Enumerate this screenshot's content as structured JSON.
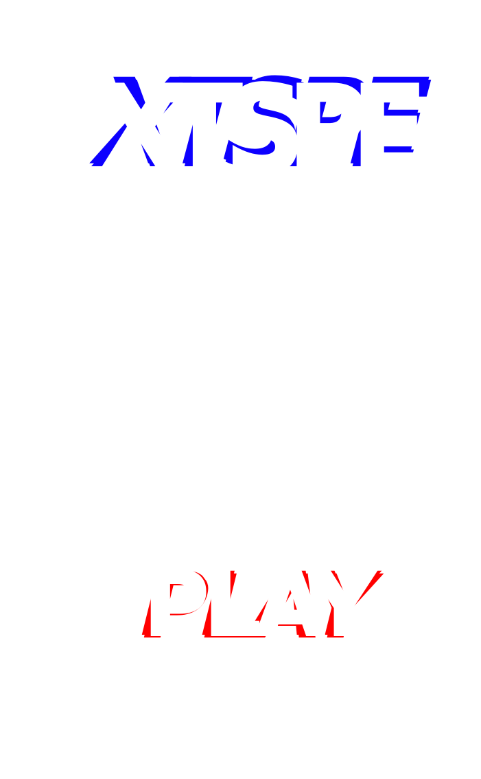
{
  "title": {
    "text": "XTSPE",
    "shadow_color": "#0d00ff",
    "front_color": "#ffffff"
  },
  "play_button": {
    "label": "PLAY",
    "shadow_color": "#ff0000",
    "front_color": "#ffffff"
  }
}
